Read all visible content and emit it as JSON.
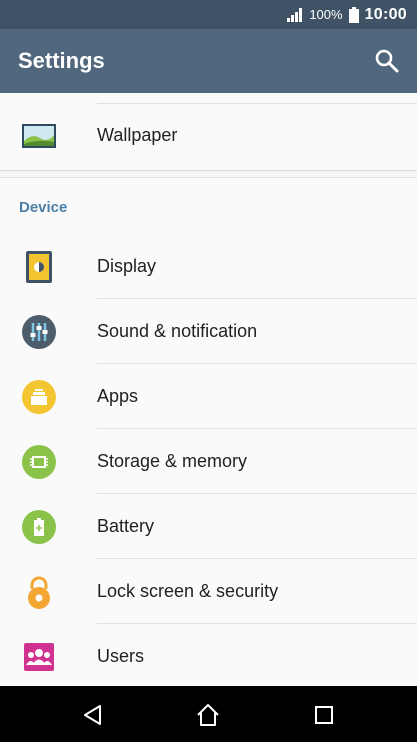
{
  "status_bar": {
    "battery": "100%",
    "time": "10:00"
  },
  "app_bar": {
    "title": "Settings"
  },
  "top_items": [
    {
      "label": "Wallpaper",
      "icon": "wallpaper-icon"
    }
  ],
  "device_section": {
    "heading": "Device",
    "items": [
      {
        "label": "Display",
        "icon": "display-icon"
      },
      {
        "label": "Sound & notification",
        "icon": "sound-icon"
      },
      {
        "label": "Apps",
        "icon": "apps-icon"
      },
      {
        "label": "Storage & memory",
        "icon": "storage-icon"
      },
      {
        "label": "Battery",
        "icon": "battery-icon"
      },
      {
        "label": "Lock screen & security",
        "icon": "lock-icon"
      },
      {
        "label": "Users",
        "icon": "users-icon"
      }
    ]
  },
  "colors": {
    "status_bar": "#3f5266",
    "app_bar": "#51677d",
    "accent": "#4a7fa8"
  }
}
